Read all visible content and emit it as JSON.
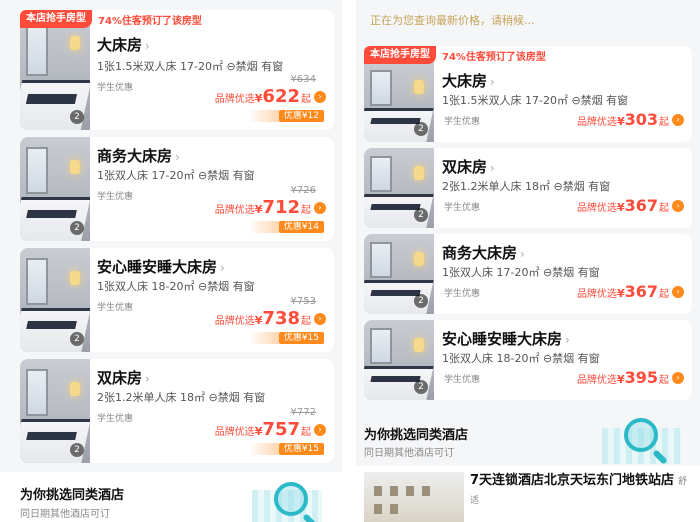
{
  "left": {
    "hot_tag": "本店抢手房型",
    "hot_note": "74%住客预订了该房型",
    "rooms": [
      {
        "name": "大床房",
        "desc": "1张1.5米双人床  17-20㎡  ⊖禁烟  有窗",
        "perk": "学生优惠",
        "original_price": "¥634",
        "brand_label": "品牌优选",
        "currency": "¥",
        "price": "622",
        "suffix": "起",
        "discount": "优惠¥12",
        "photo_count": "2"
      },
      {
        "name": "商务大床房",
        "desc": "1张双人床  17-20㎡  ⊖禁烟  有窗",
        "perk": "学生优惠",
        "original_price": "¥726",
        "brand_label": "品牌优选",
        "currency": "¥",
        "price": "712",
        "suffix": "起",
        "discount": "优惠¥14",
        "photo_count": "2"
      },
      {
        "name": "安心睡安睡大床房",
        "desc": "1张双人床  18-20㎡  ⊖禁烟  有窗",
        "perk": "学生优惠",
        "original_price": "¥753",
        "brand_label": "品牌优选",
        "currency": "¥",
        "price": "738",
        "suffix": "起",
        "discount": "优惠¥15",
        "photo_count": "2"
      },
      {
        "name": "双床房",
        "desc": "2张1.2米单人床  18㎡  ⊖禁烟  有窗",
        "perk": "学生优惠",
        "original_price": "¥772",
        "brand_label": "品牌优选",
        "currency": "¥",
        "price": "757",
        "suffix": "起",
        "discount": "优惠¥15",
        "photo_count": "2"
      }
    ],
    "similar_title": "为你挑选同类酒店",
    "similar_sub": "同日期其他酒店可订"
  },
  "right": {
    "status": "正在为您查询最新价格，请稍候...",
    "hot_tag": "本店抢手房型",
    "hot_note": "74%住客预订了该房型",
    "rooms": [
      {
        "name": "大床房",
        "desc": "1张1.5米双人床  17-20㎡  ⊖禁烟  有窗",
        "perk": "学生优惠",
        "brand_label": "品牌优选",
        "currency": "¥",
        "price": "303",
        "suffix": "起",
        "photo_count": "2"
      },
      {
        "name": "双床房",
        "desc": "2张1.2米单人床  18㎡  ⊖禁烟  有窗",
        "perk": "学生优惠",
        "brand_label": "品牌优选",
        "currency": "¥",
        "price": "367",
        "suffix": "起",
        "photo_count": "2"
      },
      {
        "name": "商务大床房",
        "desc": "1张双人床  17-20㎡  ⊖禁烟  有窗",
        "perk": "学生优惠",
        "brand_label": "品牌优选",
        "currency": "¥",
        "price": "367",
        "suffix": "起",
        "photo_count": "2"
      },
      {
        "name": "安心睡安睡大床房",
        "desc": "1张双人床  18-20㎡  ⊖禁烟  有窗",
        "perk": "学生优惠",
        "brand_label": "品牌优选",
        "currency": "¥",
        "price": "395",
        "suffix": "起",
        "photo_count": "2"
      }
    ],
    "similar_title": "为你挑选同类酒店",
    "similar_sub": "同日期其他酒店可订",
    "hotel": {
      "name": "7天连锁酒店北京天坛东门地铁站店",
      "type": "舒适"
    }
  },
  "icons": {
    "chevron": "chevron-right-icon",
    "arrow": "arrow-circle-icon",
    "search": "search-icon"
  },
  "colors": {
    "accent_red": "#ff4b3a",
    "accent_orange": "#ff8a1c",
    "status_gold": "#c8a35a",
    "teal": "#2bb9c8"
  }
}
